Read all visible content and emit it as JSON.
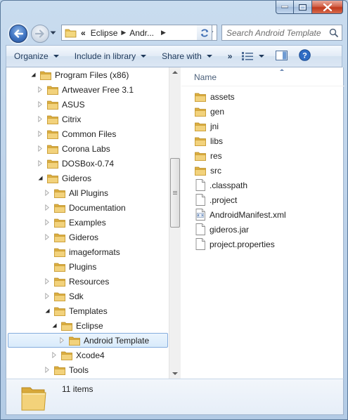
{
  "window": {
    "caption_buttons": [
      "minimize-icon",
      "maximize-icon",
      "close-icon"
    ]
  },
  "address_bar": {
    "overflow_marker": "«",
    "crumbs": [
      "Eclipse",
      "Andr..."
    ]
  },
  "search": {
    "placeholder": "Search Android Template"
  },
  "toolbar": {
    "organize": "Organize",
    "include_in_library": "Include in library",
    "share_with": "Share with",
    "more": "»"
  },
  "nav_tree": [
    {
      "label": "Program Files (x86)",
      "level": 0,
      "expander": "open"
    },
    {
      "label": "Artweaver Free 3.1",
      "level": 1,
      "expander": "closed"
    },
    {
      "label": "ASUS",
      "level": 1,
      "expander": "closed"
    },
    {
      "label": "Citrix",
      "level": 1,
      "expander": "closed"
    },
    {
      "label": "Common Files",
      "level": 1,
      "expander": "closed"
    },
    {
      "label": "Corona Labs",
      "level": 1,
      "expander": "closed"
    },
    {
      "label": "DOSBox-0.74",
      "level": 1,
      "expander": "closed"
    },
    {
      "label": "Gideros",
      "level": 1,
      "expander": "open"
    },
    {
      "label": "All Plugins",
      "level": 2,
      "expander": "closed"
    },
    {
      "label": "Documentation",
      "level": 2,
      "expander": "closed"
    },
    {
      "label": "Examples",
      "level": 2,
      "expander": "closed"
    },
    {
      "label": "Gideros",
      "level": 2,
      "expander": "closed"
    },
    {
      "label": "imageformats",
      "level": 2,
      "expander": "none"
    },
    {
      "label": "Plugins",
      "level": 2,
      "expander": "none"
    },
    {
      "label": "Resources",
      "level": 2,
      "expander": "closed"
    },
    {
      "label": "Sdk",
      "level": 2,
      "expander": "closed"
    },
    {
      "label": "Templates",
      "level": 2,
      "expander": "open"
    },
    {
      "label": "Eclipse",
      "level": 3,
      "expander": "open"
    },
    {
      "label": "Android Template",
      "level": 4,
      "expander": "closed",
      "selected": true
    },
    {
      "label": "Xcode4",
      "level": 3,
      "expander": "closed"
    },
    {
      "label": "Tools",
      "level": 2,
      "expander": "closed"
    }
  ],
  "file_list": {
    "column_name": "Name",
    "items": [
      {
        "name": "assets",
        "icon": "folder-icon"
      },
      {
        "name": "gen",
        "icon": "folder-icon"
      },
      {
        "name": "jni",
        "icon": "folder-icon"
      },
      {
        "name": "libs",
        "icon": "folder-icon"
      },
      {
        "name": "res",
        "icon": "folder-icon"
      },
      {
        "name": "src",
        "icon": "folder-icon"
      },
      {
        "name": ".classpath",
        "icon": "file-icon"
      },
      {
        "name": ".project",
        "icon": "file-icon"
      },
      {
        "name": "AndroidManifest.xml",
        "icon": "xml-file-icon"
      },
      {
        "name": "gideros.jar",
        "icon": "file-icon"
      },
      {
        "name": "project.properties",
        "icon": "file-icon"
      }
    ]
  },
  "details_pane": {
    "item_count": "11 items"
  },
  "colors": {
    "folder": "#e9c25a",
    "selection_border": "#84acdd",
    "toolbar_text": "#1e395b"
  }
}
